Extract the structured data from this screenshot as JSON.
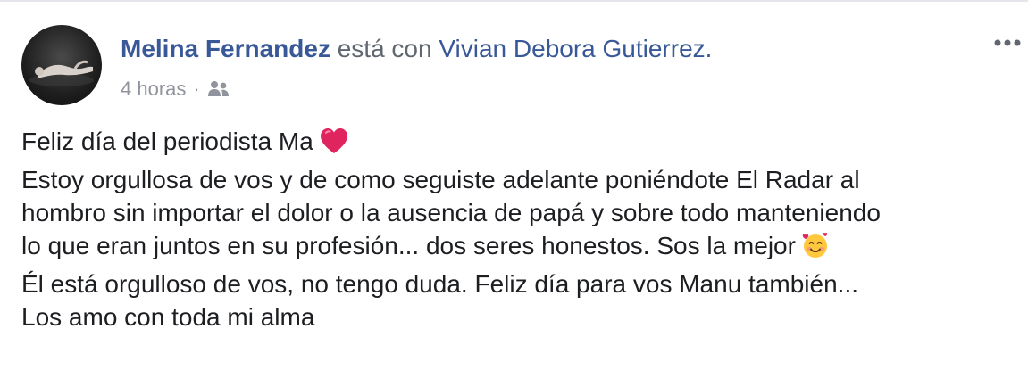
{
  "post": {
    "author_name": "Melina Fernandez",
    "with_text": "está con",
    "tagged_person": "Vivian Debora Gutierrez.",
    "timestamp": "4 horas",
    "separator": "·",
    "audience_icon": "friends-icon",
    "more_icon": "more-options-icon",
    "lines": [
      "Feliz día del periodista Ma",
      "Estoy orgullosa de vos y de como seguiste adelante poniéndote El Radar al",
      "hombro sin importar el dolor o la ausencia de papá y sobre todo manteniendo",
      "lo que eran juntos en su profesión... dos seres honestos. Sos la mejor",
      "Él está orgulloso de vos, no tengo duda. Feliz día para vos Manu también...",
      "Los amo con toda mi alma"
    ],
    "emojis": {
      "line_1": "red-heart-emoji",
      "line_4": "smiling-face-with-hearts-emoji"
    }
  },
  "colors": {
    "link_blue": "#385898",
    "text_dark": "#1c1e21",
    "meta_grey": "#90949c",
    "with_grey": "#606770",
    "heart_red": "#e0245e"
  }
}
